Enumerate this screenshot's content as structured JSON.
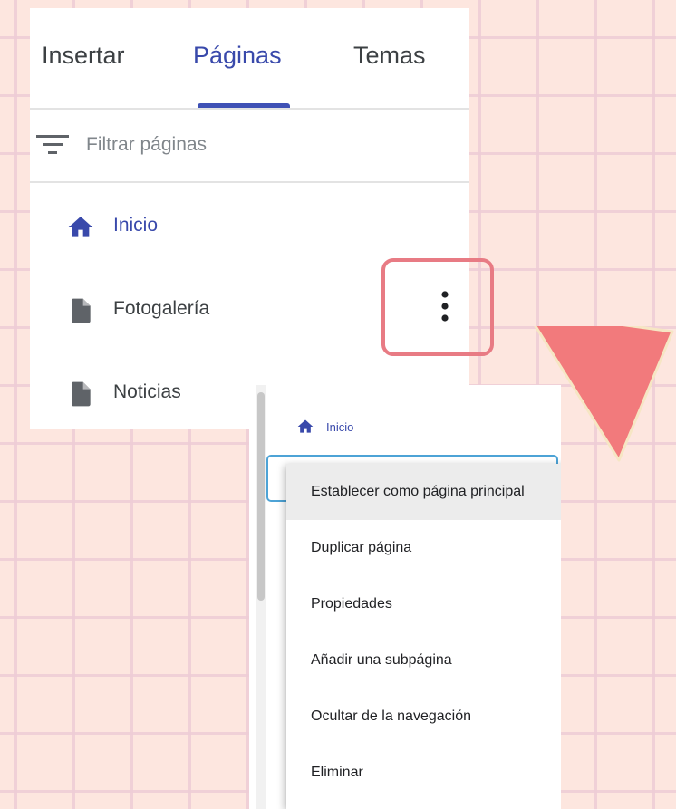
{
  "tabs": [
    {
      "label": "Insertar"
    },
    {
      "label": "Páginas"
    },
    {
      "label": "Temas"
    }
  ],
  "filter": {
    "placeholder": "Filtrar páginas"
  },
  "pages": [
    {
      "label": "Inicio",
      "icon": "home-icon",
      "active": true
    },
    {
      "label": "Fotogalería",
      "icon": "page-icon"
    },
    {
      "label": "Noticias",
      "icon": "page-icon"
    }
  ],
  "submenu": {
    "home_label": "Inicio",
    "items": [
      {
        "label": "Establecer como página principal"
      },
      {
        "label": "Duplicar página"
      },
      {
        "label": "Propiedades"
      },
      {
        "label": "Añadir una subpágina"
      },
      {
        "label": "Ocultar de la navegación"
      },
      {
        "label": "Eliminar"
      }
    ]
  },
  "colors": {
    "background": "#fde6df",
    "accent": "#3f51b5",
    "highlight_box": "#e87b84",
    "arrow": "#f27a7c"
  }
}
